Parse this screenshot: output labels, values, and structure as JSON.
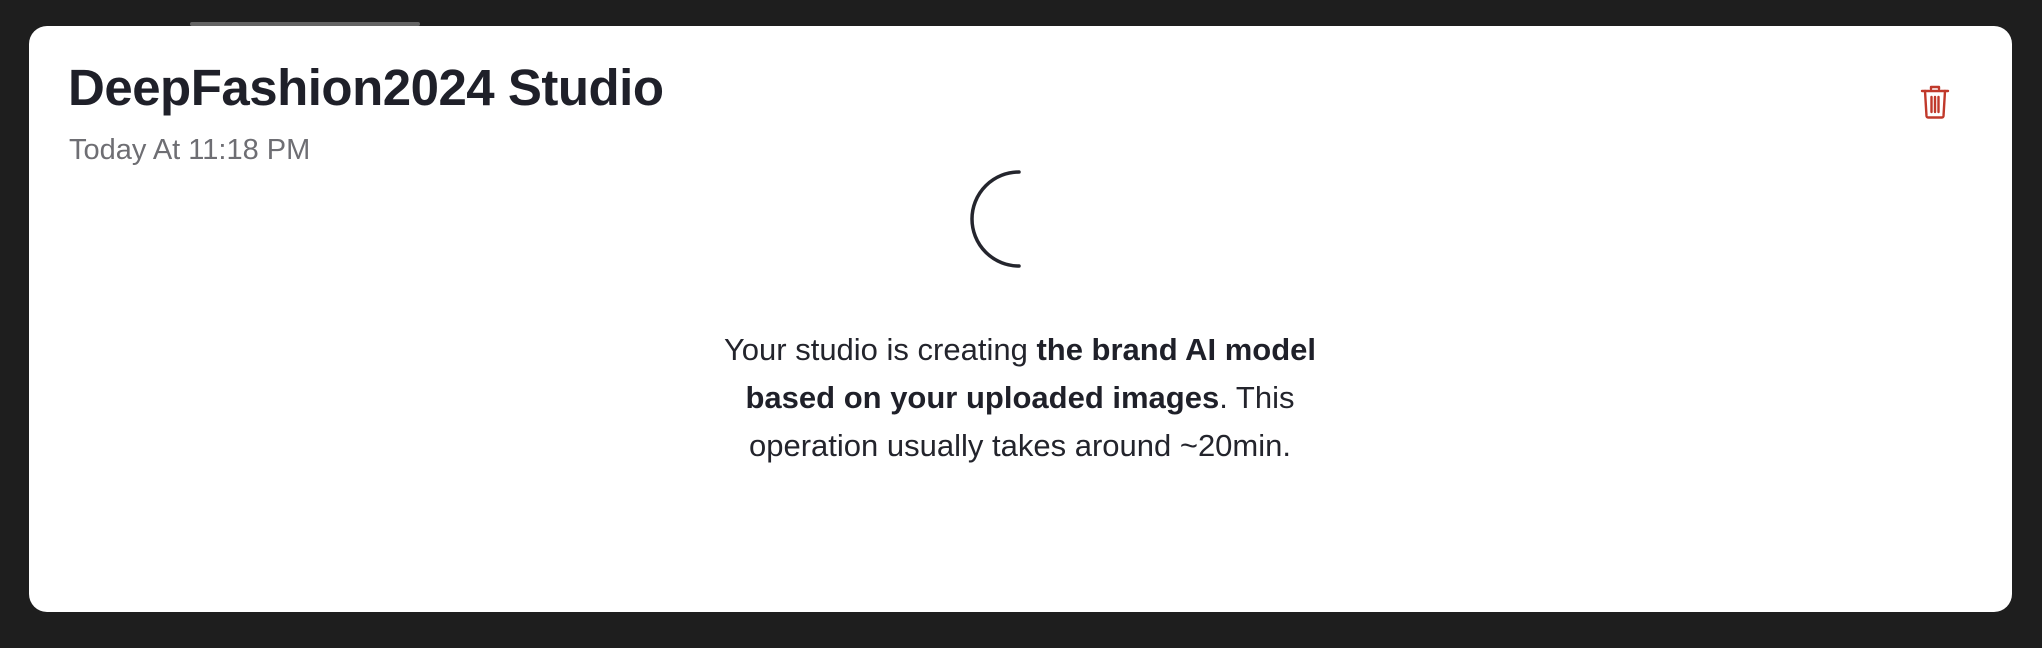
{
  "studio": {
    "title_main": "DeepFashion2024",
    "title_suffix": "Studio",
    "timestamp": "Today At 11:18 PM"
  },
  "actions": {
    "delete_icon": "trash-icon"
  },
  "status": {
    "loading_indicator": "spinner",
    "message_prefix": "Your studio is creating ",
    "message_bold": "the brand AI model based on your uploaded images",
    "message_period": ".",
    "message_suffix": "This operation usually takes around ~20min."
  },
  "colors": {
    "background": "#1e1e1e",
    "card": "#ffffff",
    "title": "#1f2029",
    "timestamp": "#6e6e73",
    "delete_icon": "#c0392b",
    "spinner": "#24252d"
  }
}
